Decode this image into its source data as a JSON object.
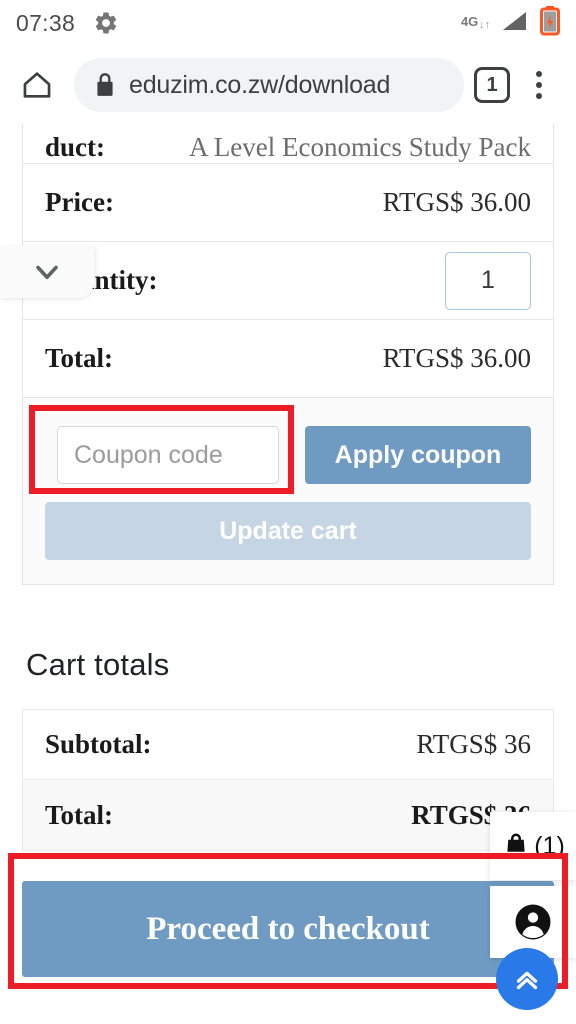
{
  "status_bar": {
    "clock": "07:38",
    "gear_icon": "gear-icon",
    "network_label": "4G",
    "network_arrows": "↓↑",
    "signal_icon": "signal-triangle-icon",
    "battery_icon": "battery-charging-icon"
  },
  "browser": {
    "home_icon": "home-icon",
    "lock_icon": "lock-icon",
    "url": "eduzim.co.zw/download",
    "tab_count": "1",
    "menu_icon": "kebab-menu-icon"
  },
  "overlay": {
    "chevron_icon": "chevron-down-icon"
  },
  "cart": {
    "product_label": "duct:",
    "product_name": "A Level Economics Study Pack",
    "price_label": "Price:",
    "price_value": "RTGS$ 36.00",
    "quantity_label": "Quantity:",
    "quantity_value": "1",
    "total_label": "Total:",
    "total_value": "RTGS$ 36.00",
    "coupon_placeholder": "Coupon code",
    "coupon_value": "",
    "apply_coupon_label": "Apply coupon",
    "update_cart_label": "Update cart"
  },
  "totals": {
    "heading": "Cart totals",
    "rows": [
      {
        "label": "Subtotal:",
        "value": "RTGS$ 36"
      },
      {
        "label": "Total:",
        "value": "RTGS$ 36"
      }
    ],
    "checkout_label": "Proceed to checkout"
  },
  "side_widget": {
    "bag_icon": "shopping-bag-icon",
    "bag_count": "(1)",
    "account_icon": "account-person-icon"
  },
  "scroll_top": {
    "icon": "double-chevron-up-icon"
  },
  "colors": {
    "button_blue": "#6f9bc3",
    "button_disabled": "#c6d5e4",
    "fab_blue": "#2979e8",
    "annotation_red": "#ee1c25",
    "battery_orange": "#ff5722"
  }
}
